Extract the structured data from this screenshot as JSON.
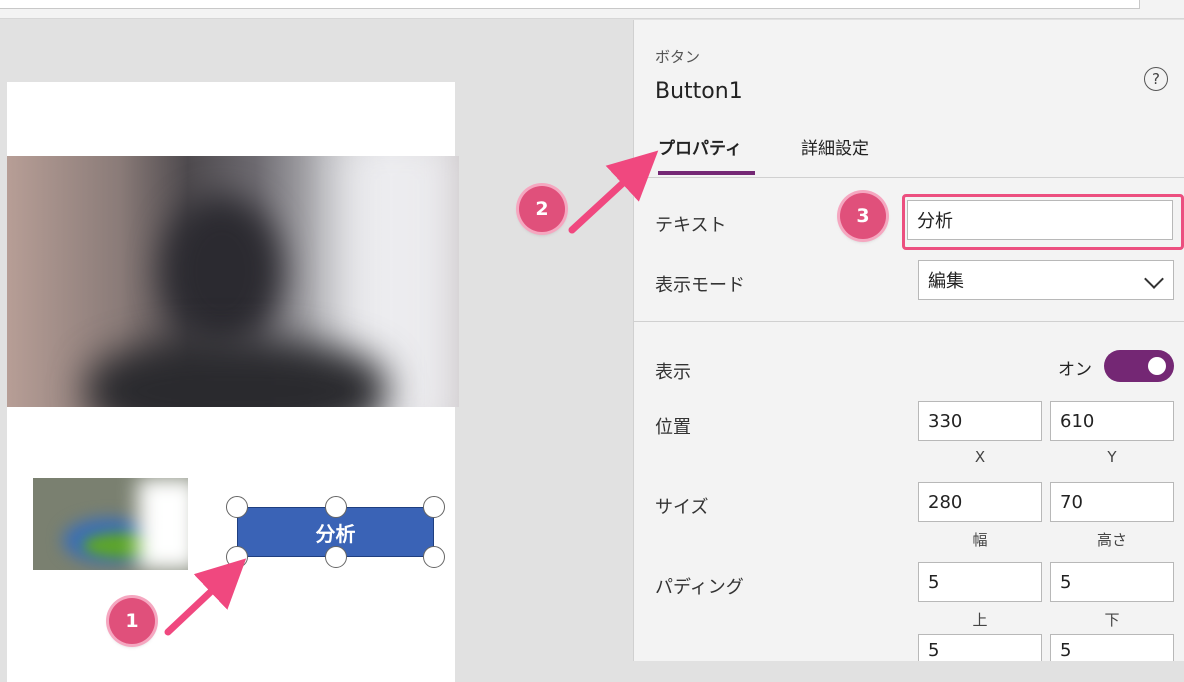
{
  "canvas": {
    "button_label": "分析"
  },
  "callouts": [
    "1",
    "2",
    "3"
  ],
  "panel": {
    "control_kind": "ボタン",
    "control_name": "Button1",
    "help_icon": "?",
    "tabs": [
      {
        "label": "プロパティ",
        "active": true
      },
      {
        "label": "詳細設定",
        "active": false
      }
    ],
    "text": {
      "label": "テキスト",
      "value": "分析"
    },
    "display_mode": {
      "label": "表示モード",
      "value": "編集"
    },
    "visible": {
      "label": "表示",
      "toggle_text": "オン",
      "on": true
    },
    "position": {
      "label": "位置",
      "x": "330",
      "y": "610",
      "x_label": "X",
      "y_label": "Y"
    },
    "size": {
      "label": "サイズ",
      "width": "280",
      "height": "70",
      "width_label": "幅",
      "height_label": "高さ"
    },
    "padding": {
      "label": "パディング",
      "top": "5",
      "bottom": "5",
      "top_label": "上",
      "bottom_label": "下",
      "left": "5",
      "right": "5"
    }
  },
  "colors": {
    "accent": "#742774",
    "callout": "#e0507b",
    "button": "#3a63b6"
  }
}
